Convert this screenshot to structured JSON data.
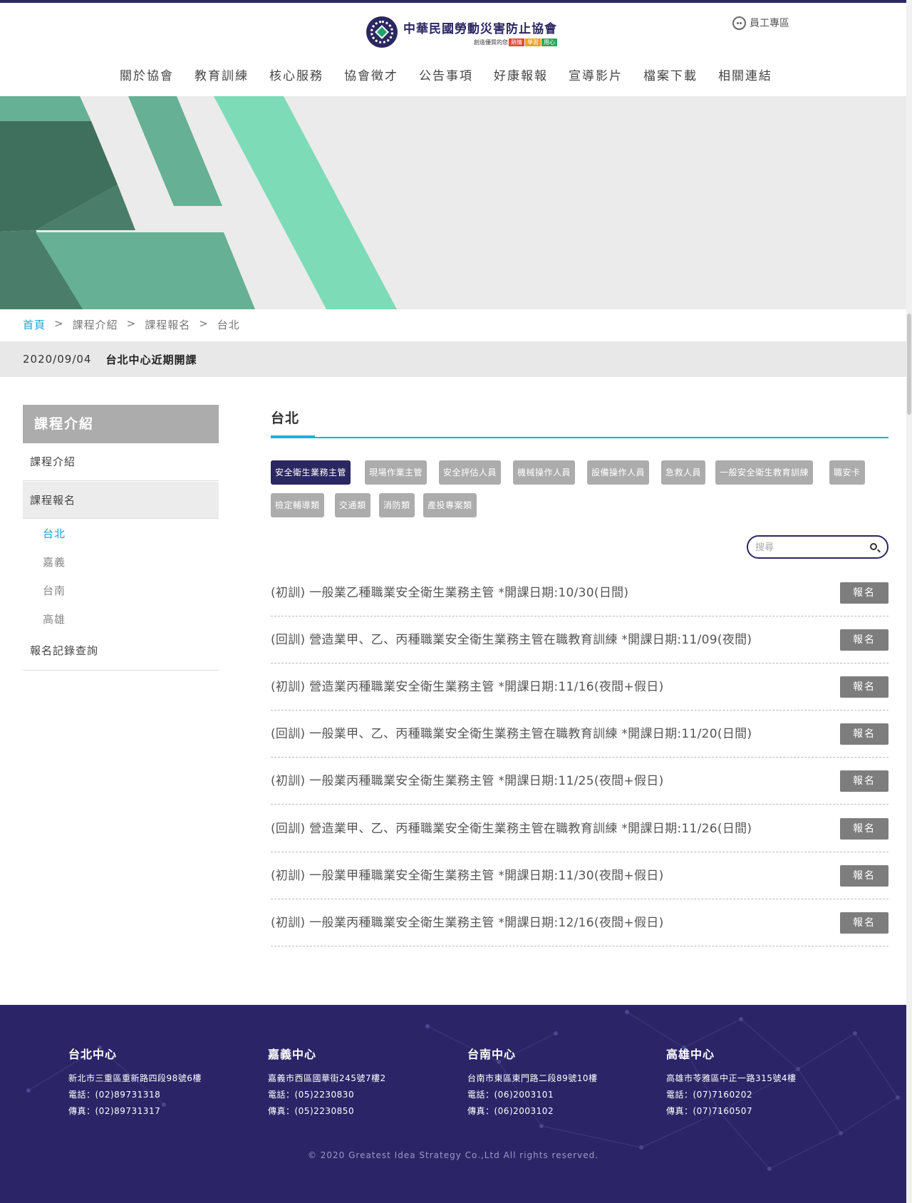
{
  "header": {
    "logo_title": "中華民國勞動災害防止協會",
    "logo_tagline": "創造優質的您",
    "logo_tags": [
      "熱情",
      "學習",
      "用心"
    ],
    "staff_link": "員工專區"
  },
  "nav": [
    "關於協會",
    "教育訓練",
    "核心服務",
    "協會徵才",
    "公告事項",
    "好康報報",
    "宣導影片",
    "檔案下載",
    "相關連結"
  ],
  "breadcrumb": [
    "首頁",
    "課程介紹",
    "課程報名",
    "台北"
  ],
  "breadcrumb_sep": ">",
  "news": {
    "date": "2020/09/04",
    "title": "台北中心近期開課"
  },
  "sidebar": {
    "heading": "課程介紹",
    "items": [
      "課程介紹",
      "課程報名",
      "報名記錄查詢"
    ],
    "subitems": [
      "台北",
      "嘉義",
      "台南",
      "高雄"
    ],
    "active_sub": "台北"
  },
  "main": {
    "title": "台北",
    "categories": [
      "安全衛生業務主管",
      "現場作業主管",
      "安全評估人員",
      "機械操作人員",
      "設備操作人員",
      "急救人員",
      "一般安全衛生教育訓練",
      "職安卡",
      "檢定輔導類",
      "交通類",
      "消防類",
      "產投專案類"
    ],
    "active_category": "安全衛生業務主管",
    "search_placeholder": "搜尋",
    "register_label": "報名",
    "courses": [
      "(初訓) 一般業乙種職業安全衛生業務主管 *開課日期:10/30(日間)",
      "(回訓) 營造業甲、乙、丙種職業安全衛生業務主管在職教育訓練 *開課日期:11/09(夜間)",
      "(初訓) 營造業丙種職業安全衛生業務主管 *開課日期:11/16(夜間+假日)",
      "(回訓) 一般業甲、乙、丙種職業安全衛生業務主管在職教育訓練 *開課日期:11/20(日間)",
      "(初訓) 一般業丙種職業安全衛生業務主管 *開課日期:11/25(夜間+假日)",
      "(回訓) 營造業甲、乙、丙種職業安全衛生業務主管在職教育訓練 *開課日期:11/26(日間)",
      "(初訓) 一般業甲種職業安全衛生業務主管 *開課日期:11/30(夜間+假日)",
      "(初訓) 一般業丙種職業安全衛生業務主管 *開課日期:12/16(夜間+假日)"
    ]
  },
  "footer": {
    "centers": [
      {
        "name": "台北中心",
        "address": "新北市三重區重新路四段98號6樓",
        "phone": "電話：(02)89731318",
        "fax": "傳真：(02)89731317"
      },
      {
        "name": "嘉義中心",
        "address": "嘉義市西區國華街245號7樓2",
        "phone": "電話：(05)2230830",
        "fax": "傳真：(05)2230850"
      },
      {
        "name": "台南中心",
        "address": "台南市東區東門路二段89號10樓",
        "phone": "電話：(06)2003101",
        "fax": "傳真：(06)2003102"
      },
      {
        "name": "高雄中心",
        "address": "高雄市苓雅區中正一路315號4樓",
        "phone": "電話：(07)7160202",
        "fax": "傳真：(07)7160507"
      }
    ],
    "copyright": "© 2020 Greatest Idea Strategy Co.,Ltd All rights reserved."
  },
  "colors": {
    "brand": "#2b2760",
    "accent": "#19b3d8",
    "link": "#1aa1d6",
    "button_gray": "#7d7d7d",
    "footer_bg": "#2b2567",
    "banner_green_dark": "#4a7d6a",
    "banner_green_mid": "#66b095",
    "banner_green_light": "#7ddbb8"
  },
  "icons": {
    "staff": "face-icon",
    "search": "search-icon",
    "logo": "logo-emblem-icon"
  }
}
